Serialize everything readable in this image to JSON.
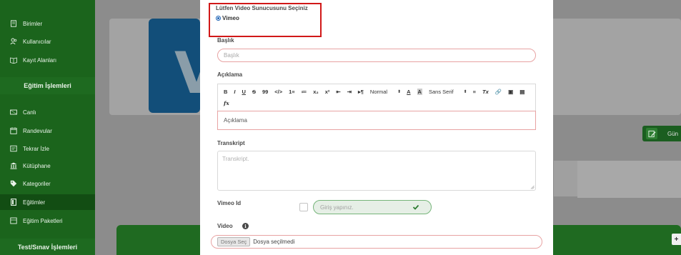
{
  "sidebar": {
    "items_top": [
      {
        "label": "Birimler",
        "icon": "book-icon"
      },
      {
        "label": "Kullanıcılar",
        "icon": "users-icon"
      },
      {
        "label": "Kayıt Alanları",
        "icon": "book-open-icon"
      }
    ],
    "section_egitim": "Eğitim İşlemleri",
    "items_egitim": [
      {
        "label": "Canlı",
        "icon": "broadcast-icon"
      },
      {
        "label": "Randevular",
        "icon": "calendar-icon"
      },
      {
        "label": "Tekrar İzle",
        "icon": "replay-icon"
      },
      {
        "label": "Kütüphane",
        "icon": "library-icon"
      },
      {
        "label": "Kategoriler",
        "icon": "tag-icon"
      },
      {
        "label": "Eğitimler",
        "icon": "document-icon",
        "active": true
      },
      {
        "label": "Eğitim Paketleri",
        "icon": "package-icon"
      }
    ],
    "section_test": "Test/Sınav İşlemleri"
  },
  "background": {
    "side_button_label": "Gün",
    "plus_label": "+"
  },
  "modal": {
    "provider_label": "Lütfen Video Sunucusunu Seçiniz",
    "provider_option": "Vimeo",
    "baslik_label": "Başlık",
    "baslik_placeholder": "Başlık",
    "aciklama_label": "Açıklama",
    "toolbar": {
      "bold": "B",
      "italic": "I",
      "underline": "U",
      "strike": "S",
      "quote": "99",
      "code": "</>",
      "ol": "1≡",
      "ul": "≔",
      "sub": "x₂",
      "sup": "x²",
      "outdent": "⇤",
      "indent": "⇥",
      "rtl": "▸¶",
      "header_select": "Normal",
      "font_select": "Sans Serif",
      "clean": "Tx",
      "formula": "fx"
    },
    "aciklama_value": "Açıklama",
    "transkript_label": "Transkript",
    "transkript_placeholder": "Transkript.",
    "vimeo_id_label": "Vimeo Id",
    "vimeo_id_placeholder": "Giriş yapınız.",
    "video_label": "Video",
    "file_button": "Dosya Seç",
    "file_status": "Dosya seçilmedi"
  },
  "colors": {
    "sidebar": "#1b641c",
    "highlight": "#d11818",
    "input_border": "#e8a3a3",
    "success": "#2e7d32"
  }
}
